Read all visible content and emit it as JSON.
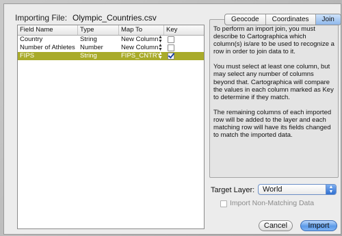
{
  "dialog": {
    "importing_label": "Importing File:",
    "file_name": "Olympic_Countries.csv"
  },
  "table": {
    "headers": [
      "Field Name",
      "Type",
      "Map To",
      "Key"
    ],
    "rows": [
      {
        "field": "Country",
        "type": "String",
        "map_to": "New Column",
        "key": false,
        "selected": false
      },
      {
        "field": "Number of Athletes",
        "type": "Number",
        "map_to": "New Column",
        "key": false,
        "selected": false
      },
      {
        "field": "FIPS",
        "type": "String",
        "map_to": "FIPS_CNTRY",
        "key": true,
        "selected": true
      }
    ]
  },
  "tabs": {
    "items": [
      "Geocode",
      "Coordinates",
      "Join"
    ],
    "active": "Join"
  },
  "panel": {
    "paragraphs": [
      "To perform an import join, you must describe to Cartographica which column(s) is/are to be used to recognize a row in order to join data to it.",
      "You must select at least one column, but may select any number of columns beyond that.  Cartographica will compare the values in each column marked as Key to determine if they match.",
      "The remaining columns of each imported row will be added to the layer and each matching row will have its fields changed to match the imported data."
    ]
  },
  "target": {
    "label": "Target Layer:",
    "value": "World"
  },
  "non_matching": {
    "label": "Import Non-Matching Data",
    "checked": false,
    "enabled": false
  },
  "buttons": {
    "cancel": "Cancel",
    "import": "Import"
  },
  "colors": {
    "selected_row": "#a9ab2a",
    "accent": "#5c9ae8"
  },
  "icons": {
    "spinner": "up-down-arrows-icon",
    "checkbox": "checkbox-icon",
    "popup_arrow": "popup-arrows-icon"
  }
}
